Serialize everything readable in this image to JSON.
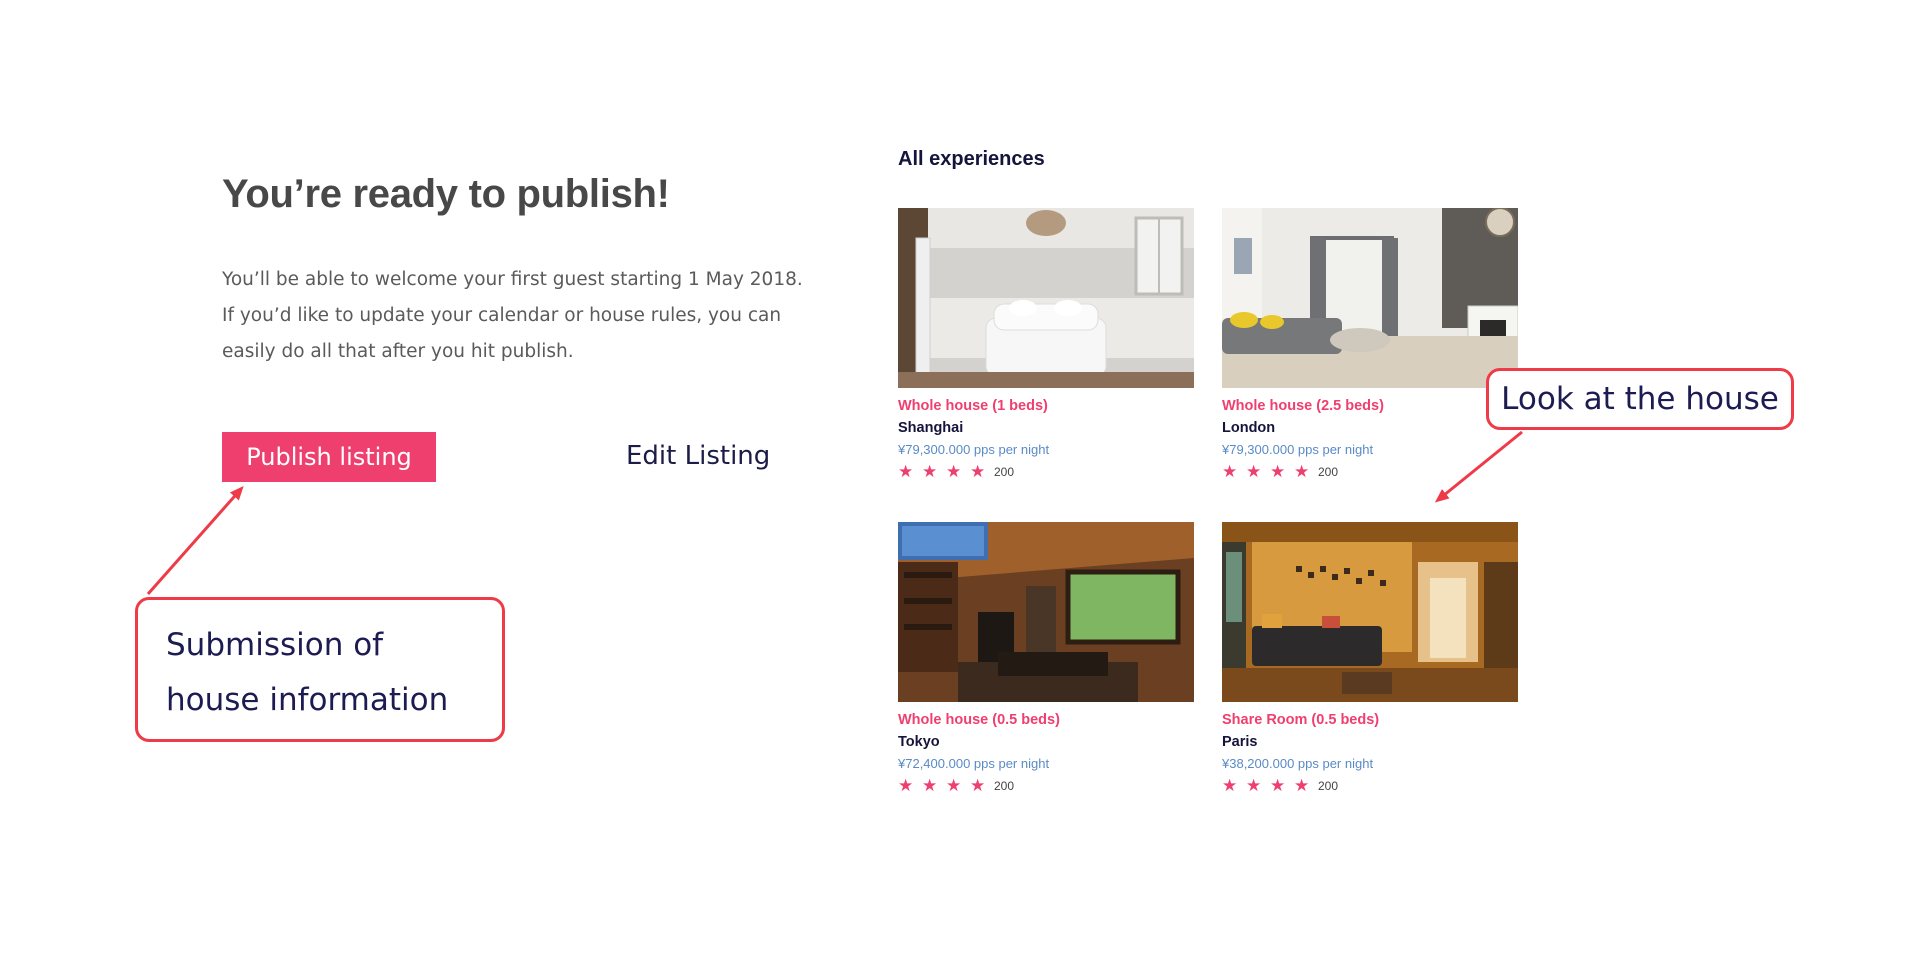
{
  "publish": {
    "title": "You’re ready to publish!",
    "description": "You’ll be able to welcome your first guest starting 1 May 2018. If you’d like to update your calendar or house rules, you can easily do all that after you hit publish.",
    "publish_button": "Publish listing",
    "edit_link": "Edit Listing"
  },
  "experiences": {
    "title": "All experiences",
    "listings": [
      {
        "type": "Whole house (1 beds)",
        "city": "Shanghai",
        "price": "¥79,300.000 pps per night",
        "rating_count": "200",
        "stars": 4
      },
      {
        "type": "Whole house (2.5 beds)",
        "city": "London",
        "price": "¥79,300.000 pps per night",
        "rating_count": "200",
        "stars": 4
      },
      {
        "type": "Whole house (0.5 beds)",
        "city": "Tokyo",
        "price": "¥72,400.000 pps per night",
        "rating_count": "200",
        "stars": 4
      },
      {
        "type": "Share Room (0.5 beds)",
        "city": "Paris",
        "price": "¥38,200.000 pps per night",
        "rating_count": "200",
        "stars": 4
      }
    ]
  },
  "annotations": {
    "submission": "Submission of house information",
    "look": "Look at the house"
  },
  "colors": {
    "accent": "#ef3f6f",
    "heading": "#484848",
    "navy": "#14143c",
    "price": "#5a8ac6",
    "annotation_border": "#ef3a47"
  },
  "icons": {
    "star": "star-icon"
  }
}
